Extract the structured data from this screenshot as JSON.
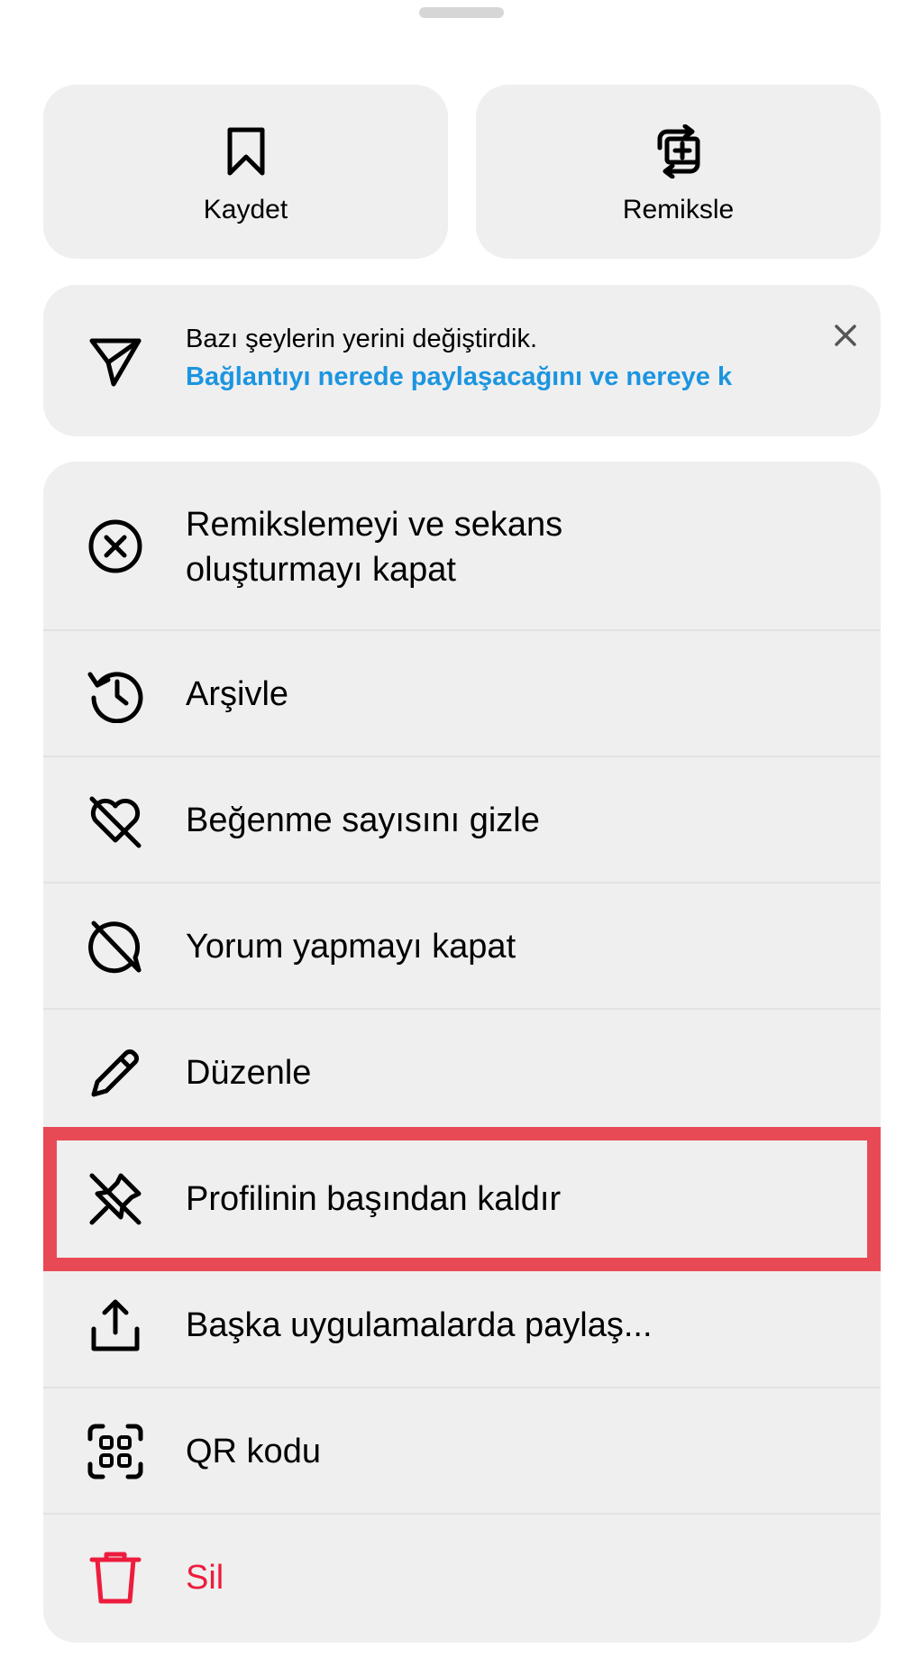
{
  "top_actions": [
    {
      "label": "Kaydet",
      "icon": "bookmark-icon"
    },
    {
      "label": "Remiksle",
      "icon": "remix-icon"
    }
  ],
  "notice": {
    "title": "Bazı şeylerin yerini değiştirdik.",
    "link": "Bağlantıyı nerede paylaşacağını ve nereye k",
    "icon": "send-icon",
    "close_icon": "close-icon"
  },
  "menu": {
    "items": [
      {
        "label": "Remikslemeyi ve sekans oluşturmayı kapat",
        "line1": "Remikslemeyi ve sekans",
        "line2": "oluşturmayı kapat",
        "icon": "circle-x-icon"
      },
      {
        "label": "Arşivle",
        "icon": "archive-history-icon"
      },
      {
        "label": "Beğenme sayısını gizle",
        "icon": "heart-off-icon"
      },
      {
        "label": "Yorum yapmayı kapat",
        "icon": "comment-off-icon"
      },
      {
        "label": "Düzenle",
        "icon": "pencil-icon"
      },
      {
        "label": "Profilinin başından kaldır",
        "icon": "unpin-icon"
      },
      {
        "label": "Başka uygulamalarda paylaş...",
        "icon": "share-icon"
      },
      {
        "label": "QR kodu",
        "icon": "qr-code-icon"
      },
      {
        "label": "Sil",
        "icon": "trash-icon"
      }
    ]
  },
  "colors": {
    "background": "#ffffff",
    "card": "#efefef",
    "link": "#1c95e0",
    "danger": "#ed1c3d",
    "highlight": "#e84a55"
  }
}
